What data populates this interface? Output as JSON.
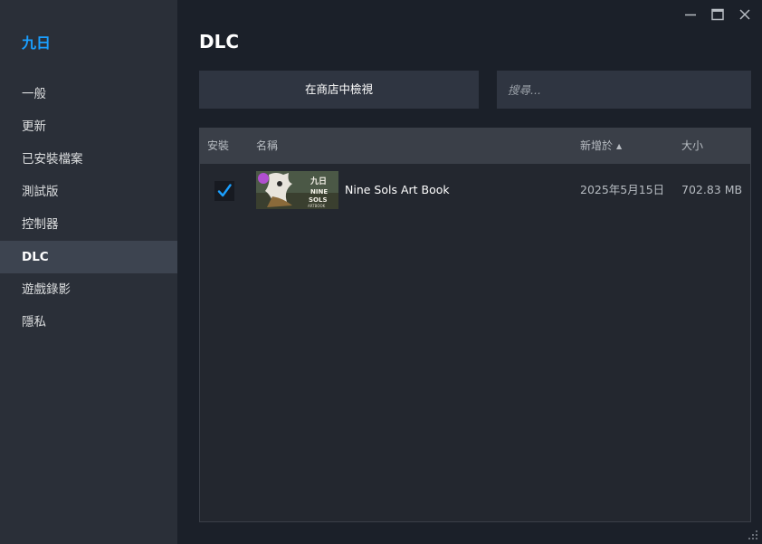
{
  "window": {
    "controls": {
      "minimize_icon": "minimize-icon",
      "maximize_icon": "maximize-icon",
      "close_icon": "close-icon"
    }
  },
  "sidebar": {
    "game_title": "九日",
    "items": [
      {
        "label": "一般",
        "active": false
      },
      {
        "label": "更新",
        "active": false
      },
      {
        "label": "已安裝檔案",
        "active": false
      },
      {
        "label": "測試版",
        "active": false
      },
      {
        "label": "控制器",
        "active": false
      },
      {
        "label": "DLC",
        "active": true
      },
      {
        "label": "遊戲錄影",
        "active": false
      },
      {
        "label": "隱私",
        "active": false
      }
    ]
  },
  "main": {
    "title": "DLC",
    "store_button_label": "在商店中檢視",
    "search": {
      "placeholder": "搜尋...",
      "value": ""
    },
    "table": {
      "headers": {
        "installed": "安裝",
        "name": "名稱",
        "added": "新增於",
        "size": "大小"
      },
      "sort": {
        "column": "added",
        "direction": "ascending"
      },
      "rows": [
        {
          "installed": true,
          "name": "Nine Sols Art Book",
          "added": "2025年5月15日",
          "size": "702.83 MB",
          "thumbnail_text": "九日 NINE SOLS ARTBOOK"
        }
      ]
    }
  },
  "colors": {
    "accent": "#1a9fff",
    "sidebar_bg": "#2a2f38",
    "main_bg": "#1b2029",
    "active_item_bg": "#3d4450",
    "panel_bg": "#23272f",
    "header_bg": "#3a3f48"
  }
}
